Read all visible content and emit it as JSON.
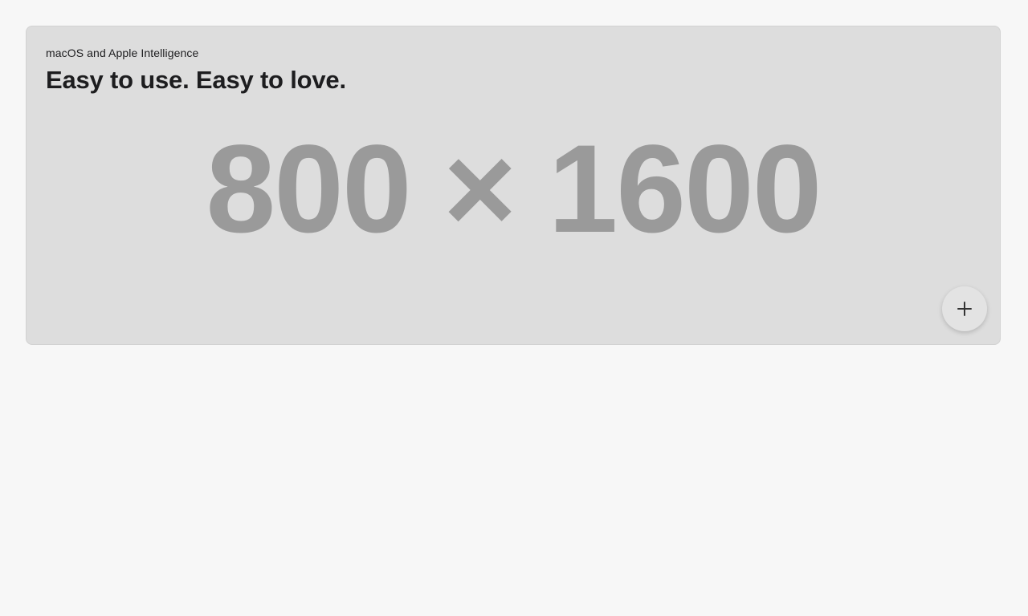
{
  "card": {
    "eyebrow": "macOS and Apple Intelligence",
    "headline": "Easy to use. Easy to love.",
    "image_placeholder_text": "800 × 1600",
    "add_button_icon": "plus-icon"
  },
  "colors": {
    "page_background": "#f7f7f7",
    "card_background": "#dddddd",
    "placeholder_text": "#9a9a9a",
    "headline_text": "#1d1d1f"
  }
}
